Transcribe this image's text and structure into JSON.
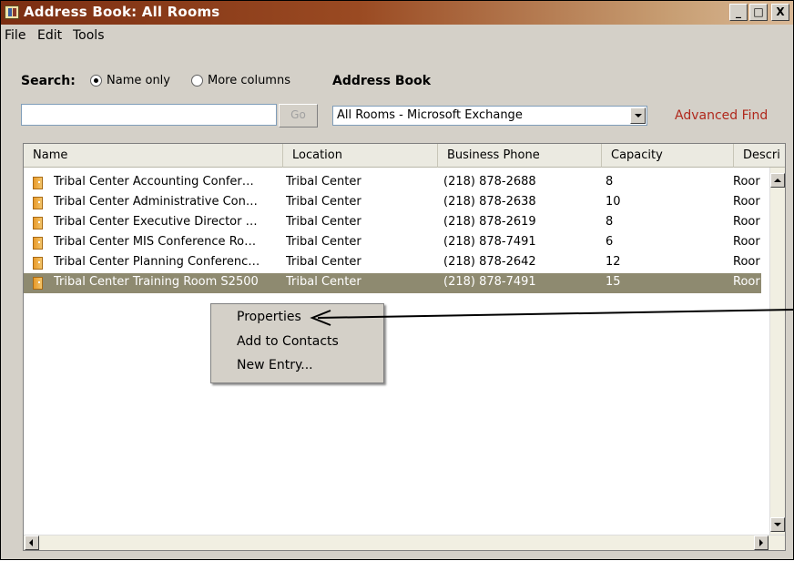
{
  "window": {
    "title": "Address Book: All Rooms",
    "controls": {
      "minimize": "_",
      "maximize": "□",
      "close": "X"
    }
  },
  "menu": [
    "File",
    "Edit",
    "Tools"
  ],
  "search": {
    "label": "Search:",
    "options": [
      "Name only",
      "More columns"
    ],
    "selected": "Name only",
    "query": "",
    "go_label": "Go"
  },
  "address_book": {
    "label": "Address Book",
    "selected": "All Rooms - Microsoft Exchange",
    "advanced_find": "Advanced Find"
  },
  "columns": [
    "Name",
    "Location",
    "Business Phone",
    "Capacity",
    "Descri"
  ],
  "rows": [
    {
      "name": "Tribal Center Accounting Confer…",
      "location": "Tribal Center",
      "phone": "(218) 878-2688",
      "capacity": "8",
      "description": "Roor"
    },
    {
      "name": "Tribal Center Administrative Con…",
      "location": "Tribal Center",
      "phone": "(218) 878-2638",
      "capacity": "10",
      "description": "Roor"
    },
    {
      "name": "Tribal Center Executive Director …",
      "location": "Tribal Center",
      "phone": "(218) 878-2619",
      "capacity": "8",
      "description": "Roor"
    },
    {
      "name": "Tribal Center MIS Conference Ro…",
      "location": "Tribal Center",
      "phone": "(218) 878-7491",
      "capacity": "6",
      "description": "Roor"
    },
    {
      "name": "Tribal Center Planning Conferenc…",
      "location": "Tribal Center",
      "phone": "(218) 878-2642",
      "capacity": "12",
      "description": "Roor"
    },
    {
      "name": "Tribal Center Training Room S2500",
      "location": "Tribal Center",
      "phone": "(218) 878-7491",
      "capacity": "15",
      "description": "Roor"
    }
  ],
  "selected_row": "Tribal Center Training Room S2500",
  "context_menu": [
    "Properties",
    "Add to Contacts",
    "New Entry..."
  ],
  "colors": {
    "titlebar_start": "#7b2e12",
    "titlebar_end": "#d9b896",
    "selection": "#8e8a70",
    "advanced_find": "#b0281c",
    "window_face": "#d4d0c8"
  }
}
